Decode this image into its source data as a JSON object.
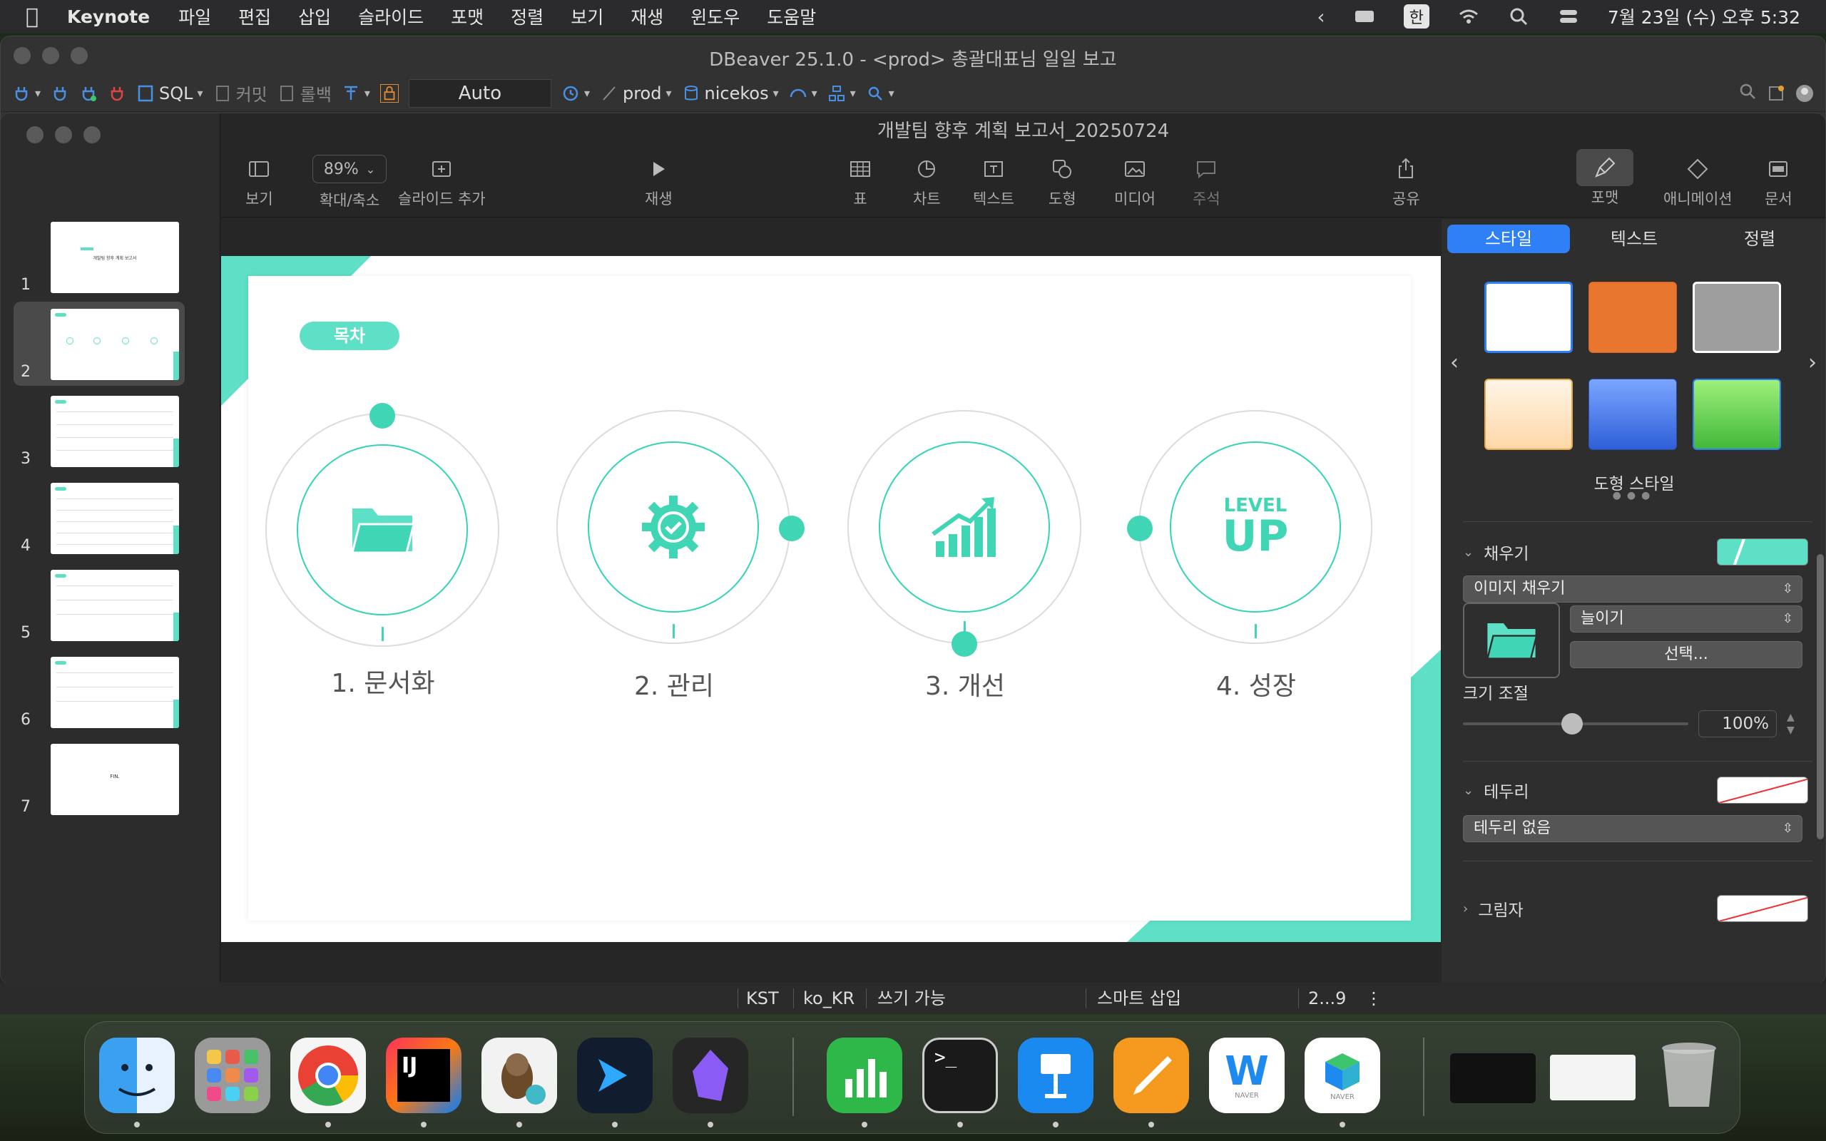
{
  "menubar": {
    "app_name": "Keynote",
    "items": [
      "파일",
      "편집",
      "삽입",
      "슬라이드",
      "포맷",
      "정렬",
      "보기",
      "재생",
      "윈도우",
      "도움말"
    ],
    "ime": "한",
    "clock": "7월 23일 (수) 오후 5:32"
  },
  "dbeaver": {
    "title": "DBeaver 25.1.0 - <prod> 총괄대표님 일일 보고",
    "toolbar": {
      "sql": "SQL",
      "commit": "커밋",
      "rollback": "롤백",
      "auto": "Auto",
      "connection": "prod",
      "schema": "nicekos"
    }
  },
  "keynote": {
    "doc_title": "개발팀 향후 계획 보고서_20250724",
    "toolbar": {
      "view": "보기",
      "zoom_value": "89%",
      "zoom": "확대/축소",
      "add_slide": "슬라이드 추가",
      "play": "재생",
      "table": "표",
      "chart": "차트",
      "text": "텍스트",
      "shape": "도형",
      "media": "미디어",
      "comment": "주석",
      "share": "공유",
      "format": "포맷",
      "animate": "애니메이션",
      "document": "문서"
    },
    "slides": [
      "1",
      "2",
      "3",
      "4",
      "5",
      "6",
      "7"
    ],
    "thumb_texts": {
      "slide1": "개발팀 향후 계획 보고서",
      "slide7": "FIN."
    },
    "slide": {
      "pill": "목차",
      "steps": [
        {
          "label": "1. 문서화",
          "icon": "folder-icon"
        },
        {
          "label": "2. 관리",
          "icon": "gear-check-icon"
        },
        {
          "label": "3. 개선",
          "icon": "growth-chart-icon"
        },
        {
          "label": "4. 성장",
          "icon": "level-up-icon"
        }
      ],
      "level": "LEVEL",
      "up": "UP"
    },
    "inspector": {
      "tabs": [
        "스타일",
        "텍스트",
        "정렬"
      ],
      "shape_style": "도형 스타일",
      "fill": "채우기",
      "fill_type": "이미지 채우기",
      "stretch": "늘이기",
      "choose": "선택...",
      "scale": "크기 조절",
      "scale_value": "100%",
      "border": "테두리",
      "border_type": "테두리 없음",
      "shadow": "그림자"
    }
  },
  "statusbar": {
    "tz": "KST",
    "locale": "ko_KR",
    "mode": "쓰기 가능",
    "insert": "스마트 삽입",
    "position": "2...9"
  },
  "dock": {
    "apps": [
      "finder-icon",
      "launchpad-icon",
      "chrome-icon",
      "intellij-icon",
      "dbeaver-icon",
      "vscode-icon",
      "obsidian-icon",
      "numbers-icon",
      "terminal-icon",
      "keynote-icon",
      "pages-icon",
      "naver-whale-icon",
      "naver-works-icon",
      "trash-icon"
    ],
    "naver_label": "NAVER"
  },
  "colors": {
    "accent": "#5de0c6",
    "selected_tab": "#2f7ff7"
  }
}
